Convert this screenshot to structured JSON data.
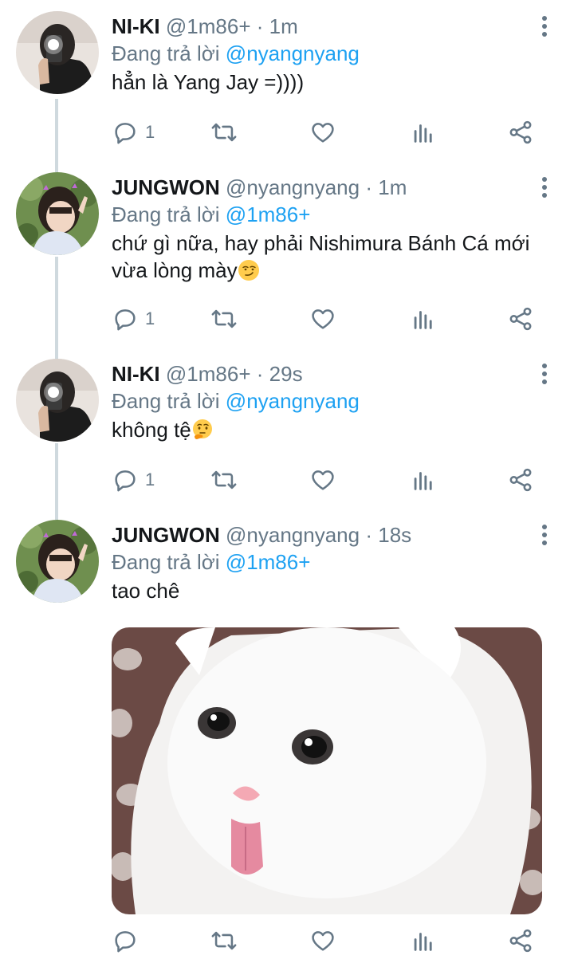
{
  "tweets": [
    {
      "name": "NI-KI",
      "handle": "@1m86+",
      "time": "1m",
      "reply_prefix": "Đang trả lời",
      "reply_to": "@nyangnyang",
      "text": "hẳn là Yang Jay =))))",
      "reply_count": "1",
      "avatar": "niki-avatar"
    },
    {
      "name": "JUNGWON",
      "handle": "@nyangnyang",
      "time": "1m",
      "reply_prefix": "Đang trả lời",
      "reply_to": "@1m86+",
      "text": "chứ gì nữa, hay phải Nishimura Bánh Cá mới vừa lòng mày",
      "emoji": "smirking-face",
      "reply_count": "1",
      "avatar": "jungwon-avatar"
    },
    {
      "name": "NI-KI",
      "handle": "@1m86+",
      "time": "29s",
      "reply_prefix": "Đang trả lời",
      "reply_to": "@nyangnyang",
      "text": "không tệ",
      "emoji": "thinking-face",
      "reply_count": "1",
      "avatar": "niki-avatar"
    },
    {
      "name": "JUNGWON",
      "handle": "@nyangnyang",
      "time": "18s",
      "reply_prefix": "Đang trả lời",
      "reply_to": "@1m86+",
      "text": "tao chê",
      "reply_count": "",
      "avatar": "jungwon-avatar",
      "media": "white-kitten-tongue-out-photo"
    }
  ],
  "separator": "·",
  "icons": {
    "reply": "reply-icon",
    "retweet": "retweet-icon",
    "like": "heart-icon",
    "analytics": "analytics-icon",
    "share": "share-icon",
    "more": "more-vertical-icon"
  },
  "colors": {
    "text": "#14171a",
    "secondary": "#657786",
    "accent": "#1da1f2",
    "thread_line": "#cfd9de"
  }
}
